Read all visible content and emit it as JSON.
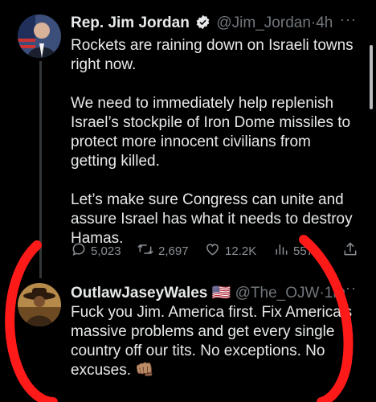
{
  "tweet1": {
    "name": "Rep. Jim Jordan",
    "handle": "@Jim_Jordan",
    "sep": "·",
    "time": "4h",
    "more": "···",
    "paragraphs": [
      "Rockets are raining down on Israeli towns right now.",
      "We need to immediately help replenish Israel’s stockpile of Iron Dome missiles to protect more innocent civilians from getting killed.",
      "Let’s make sure Congress can unite and assure Israel has what it needs to destroy Hamas."
    ],
    "stats": {
      "replies": "5,023",
      "retweets": "2,697",
      "likes": "12.2K",
      "views": "557"
    }
  },
  "tweet2": {
    "name": "OutlawJaseyWales",
    "flag": "🇺🇸",
    "handle": "@The_OJW",
    "sep": "·",
    "time": "1m",
    "more": "···",
    "text": "Fuck you Jim. America first. Fix America’s massive problems and get every single country off our tits. No exceptions. No excuses.",
    "emoji": "👊🏽"
  },
  "colors": {
    "background": "#000000",
    "text": "#e7e9ea",
    "muted": "#71767b",
    "verified": "#1d9bf0",
    "marker": "#ff1a1a"
  }
}
